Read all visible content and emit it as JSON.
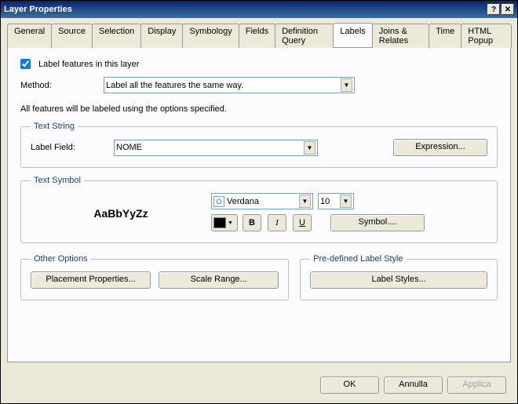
{
  "window": {
    "title": "Layer Properties"
  },
  "tabs": [
    "General",
    "Source",
    "Selection",
    "Display",
    "Symbology",
    "Fields",
    "Definition Query",
    "Labels",
    "Joins & Relates",
    "Time",
    "HTML Popup"
  ],
  "active_tab": "Labels",
  "label_features_checkbox": {
    "label": "Label features in this layer",
    "checked": true
  },
  "method": {
    "label": "Method:",
    "value": "Label all the features the same way."
  },
  "info_text": "All features will be labeled using the options specified.",
  "text_string": {
    "legend": "Text String",
    "label_field_label": "Label Field:",
    "label_field_value": "NOME",
    "expression_btn": "Expression..."
  },
  "text_symbol": {
    "legend": "Text Symbol",
    "sample": "AaBbYyZz",
    "font": "Verdana",
    "size": "10",
    "bold": "B",
    "italic": "I",
    "underline": "U",
    "symbol_btn": "Symbol...."
  },
  "other_options": {
    "legend": "Other Options",
    "placement_btn": "Placement Properties...",
    "scale_btn": "Scale Range..."
  },
  "predefined": {
    "legend": "Pre-defined Label Style",
    "styles_btn": "Label Styles..."
  },
  "footer": {
    "ok": "OK",
    "cancel": "Annulla",
    "apply": "Applica"
  }
}
